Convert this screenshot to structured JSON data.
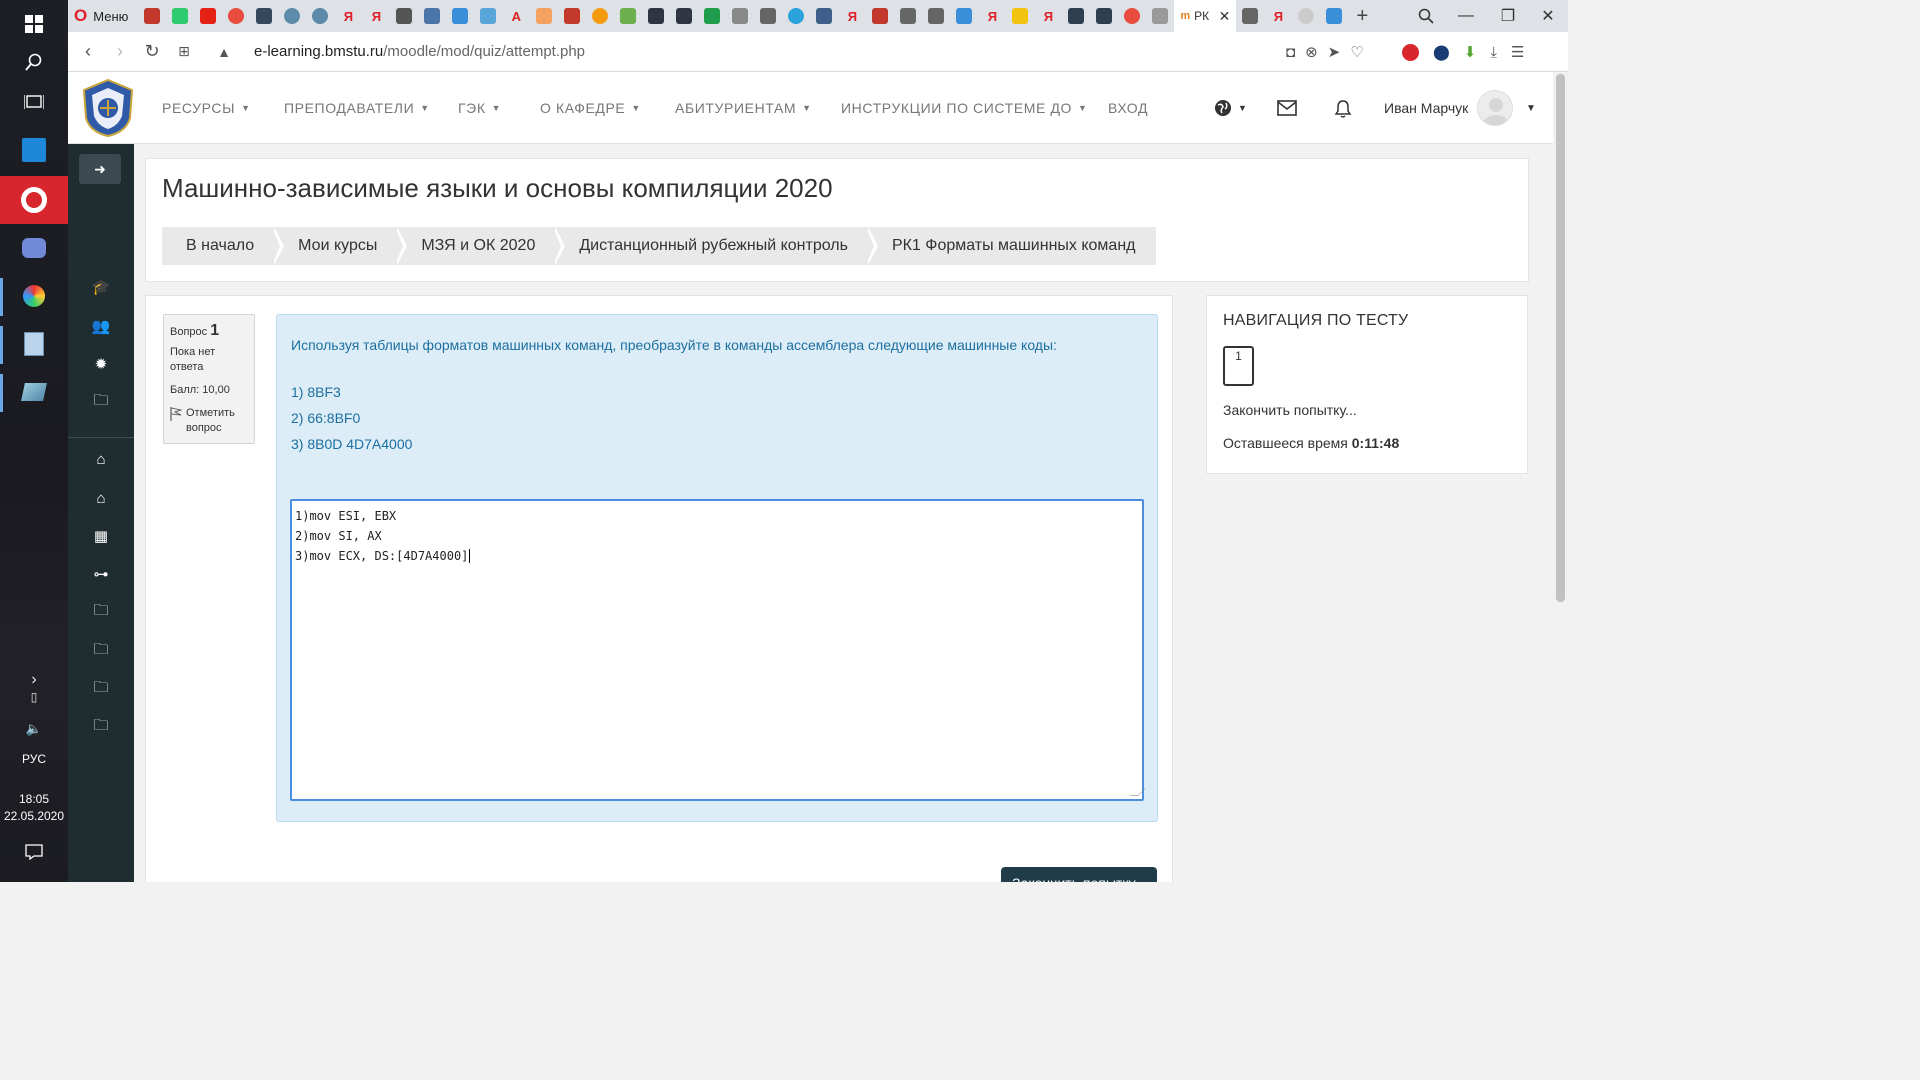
{
  "taskbar": {
    "language": "РУС",
    "time": "18:05",
    "date": "22.05.2020"
  },
  "browser": {
    "menu_label": "Меню",
    "active_tab_label": "РК",
    "url_domain": "e-learning.bmstu.ru",
    "url_path": "/moodle/mod/quiz/attempt.php"
  },
  "moodle_nav": {
    "menus": [
      {
        "label": "РЕСУРСЫ"
      },
      {
        "label": "ПРЕПОДАВАТЕЛИ"
      },
      {
        "label": "ГЭК"
      },
      {
        "label": "О КАФЕДРЕ"
      },
      {
        "label": "АБИТУРИЕНТАМ"
      },
      {
        "label": "ИНСТРУКЦИИ ПО СИСТЕМЕ ДО"
      }
    ],
    "login_label": "ВХОД",
    "user_name": "Иван Марчук"
  },
  "header": {
    "course_title": "Машинно-зависимые языки и основы компиляции 2020",
    "breadcrumb": [
      {
        "label": "В начало"
      },
      {
        "label": "Мои курсы"
      },
      {
        "label": "МЗЯ и ОК 2020"
      },
      {
        "label": "Дистанционный рубежный контроль"
      },
      {
        "label": "РК1 Форматы машинных команд"
      }
    ]
  },
  "question": {
    "label": "Вопрос",
    "number": "1",
    "status": "Пока нет ответа",
    "grade": "Балл: 10,00",
    "flag_label": "Отметить вопрос",
    "prompt": "Используя таблицы форматов машинных команд, преобразуйте в команды ассемблера следующие машинные коды:",
    "codes": [
      "1) 8BF3",
      "2) 66:8BF0",
      "3) 8B0D 4D7A4000"
    ],
    "answer_lines": [
      "1)mov ESI, EBX",
      "2)mov SI, AX",
      "3)mov ECX, DS:[4D7A4000]"
    ]
  },
  "quiz_nav": {
    "title": "НАВИГАЦИЯ ПО ТЕСТУ",
    "question_button": "1",
    "finish_link": "Закончить попытку...",
    "time_label": "Оставшееся время",
    "time_value": "0:11:48"
  },
  "finish_button": "Закончить попытку...",
  "colors": {
    "drawer": "#1f2d31",
    "question_bg": "#dcedf7",
    "prompt_text": "#1d6fa0",
    "finish_button": "#1f3c48",
    "opera_red": "#d7262d"
  }
}
